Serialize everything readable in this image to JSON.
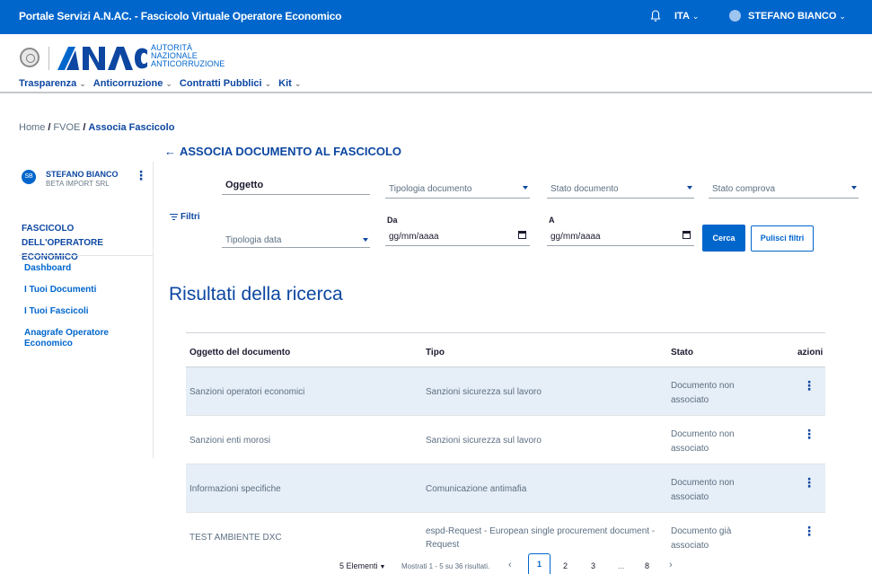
{
  "topbar": {
    "title": "Portale Servizi A.N.AC. - Fascicolo Virtuale Operatore Economico",
    "language": "ITA",
    "user": "STEFANO BIANCO"
  },
  "header": {
    "logo_text": "ANAC",
    "logo_subtitle": [
      "AUTORITÀ",
      "NAZIONALE",
      "ANTICORRUZIONE"
    ],
    "nav": [
      "Trasparenza",
      "Anticorruzione",
      "Contratti Pubblici",
      "Kit"
    ]
  },
  "breadcrumb": {
    "home": "Home",
    "fvoe": "FVOE",
    "current": "Associa Fascicolo"
  },
  "sidebar": {
    "initials": "SB",
    "name": "STEFANO BIANCO",
    "company": "BETA IMPORT SRL",
    "section": "FASCICOLO DELL'OPERATORE ECONOMICO",
    "links": [
      "Dashboard",
      "I Tuoi Documenti",
      "I Tuoi Fascicoli",
      "Anagrafe Operatore Economico"
    ]
  },
  "page": {
    "back_title": "ASSOCIA DOCUMENTO AL FASCICOLO",
    "filters_label": "Filtri"
  },
  "filters": {
    "oggetto_label": "Oggetto",
    "tipologia_documento": "Tipologia documento",
    "stato_documento": "Stato documento",
    "stato_comprova": "Stato comprova",
    "tipologia_data": "Tipologia data",
    "da_label": "Da",
    "a_label": "A",
    "date_placeholder": "gg/mm/aaaa",
    "search_button": "Cerca",
    "clear_button": "Pulisci filtri"
  },
  "results": {
    "title": "Risultati della ricerca",
    "columns": [
      "Oggetto del documento",
      "Tipo",
      "Stato",
      "azioni"
    ],
    "rows": [
      {
        "oggetto": "Sanzioni operatori economici",
        "tipo": "Sanzioni sicurezza sul lavoro",
        "stato": "Documento non associato"
      },
      {
        "oggetto": "Sanzioni enti morosi",
        "tipo": "Sanzioni sicurezza sul lavoro",
        "stato": "Documento non associato"
      },
      {
        "oggetto": "Informazioni specifiche",
        "tipo": "Comunicazione antimafia",
        "stato": "Documento non associato"
      },
      {
        "oggetto": "TEST AMBIENTE DXC",
        "tipo": "espd-Request - European single procurement document - Request",
        "stato": "Documento già associato"
      }
    ]
  },
  "pagination": {
    "page_size": "5 Elementi",
    "info": "Mostrati 1 - 5 su 36 risultati.",
    "pages": [
      "1",
      "2",
      "3",
      "...",
      "8"
    ],
    "current": "1"
  },
  "colors": {
    "primary": "#0066cc",
    "dark_blue": "#0d47a1",
    "row_highlight": "#e6eef7"
  }
}
